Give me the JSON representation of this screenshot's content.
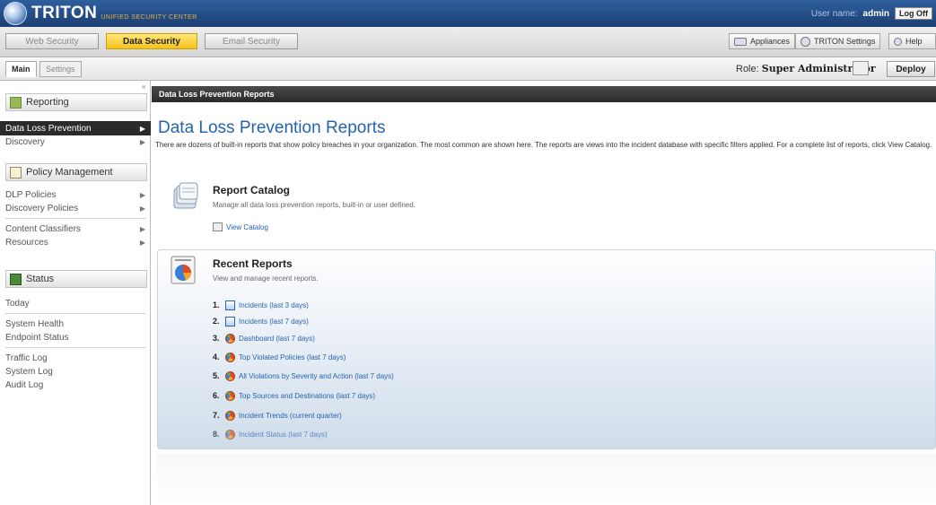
{
  "header": {
    "brand": "TRITON",
    "brand_sub": "UNIFIED SECURITY CENTER",
    "user_label": "User name:",
    "user_name": "admin",
    "logoff_label": "Log Off"
  },
  "modules": {
    "tabs": [
      {
        "label": "Web Security",
        "active": false
      },
      {
        "label": "Data Security",
        "active": true
      },
      {
        "label": "Email Security",
        "active": false
      }
    ],
    "tools": {
      "appliances": "Appliances",
      "triton_settings": "TRITON Settings",
      "help": "Help"
    }
  },
  "subbar": {
    "tabs": [
      {
        "label": "Main",
        "active": true
      },
      {
        "label": "Settings",
        "active": false
      }
    ],
    "role_label": "Role:",
    "role_value": "Super Administrator",
    "deploy_label": "Deploy"
  },
  "nav": {
    "collapse_mark": "«",
    "reporting": {
      "header": "Reporting",
      "items": [
        {
          "label": "Data Loss Prevention",
          "selected": true
        },
        {
          "label": "Discovery",
          "selected": false
        }
      ]
    },
    "policy": {
      "header": "Policy Management",
      "items": [
        "DLP Policies",
        "Discovery Policies",
        "Content Classifiers",
        "Resources"
      ]
    },
    "status": {
      "header": "Status",
      "items": [
        "Today",
        "System Health",
        "Endpoint Status",
        "Traffic Log",
        "System Log",
        "Audit Log"
      ]
    }
  },
  "content": {
    "titlebar": "Data Loss Prevention Reports",
    "heading": "Data Loss Prevention Reports",
    "intro": "There are dozens of built-in reports that show policy breaches in your organization. The most common are shown here. The reports are views into the incident database with specific filters applied. For a complete list of reports, click View Catalog.",
    "catalog": {
      "title": "Report Catalog",
      "description": "Manage all data loss prevention reports, built-in or user defined.",
      "link": "View Catalog"
    },
    "recent": {
      "title": "Recent Reports",
      "description": "View and manage recent reports.",
      "items": [
        {
          "num": "1.",
          "icon": "table-icon",
          "label": "Incidents (last 3 days)"
        },
        {
          "num": "2.",
          "icon": "table-icon",
          "label": "Incidents (last 7 days)"
        },
        {
          "num": "3.",
          "icon": "pie-chart-icon",
          "label": "Dashboard (last 7 days)"
        },
        {
          "num": "4.",
          "icon": "pie-chart-icon",
          "label": "Top Violated Policies (last 7 days)"
        },
        {
          "num": "5.",
          "icon": "pie-chart-icon",
          "label": "All Violations by Severity and Action (last 7 days)"
        },
        {
          "num": "6.",
          "icon": "pie-chart-icon",
          "label": "Top Sources and Destinations (last 7 days)"
        },
        {
          "num": "7.",
          "icon": "pie-chart-icon",
          "label": "Incident Trends (current quarter)"
        },
        {
          "num": "8.",
          "icon": "pie-chart-icon",
          "label": "Incident Status (last 7 days)"
        }
      ]
    }
  }
}
